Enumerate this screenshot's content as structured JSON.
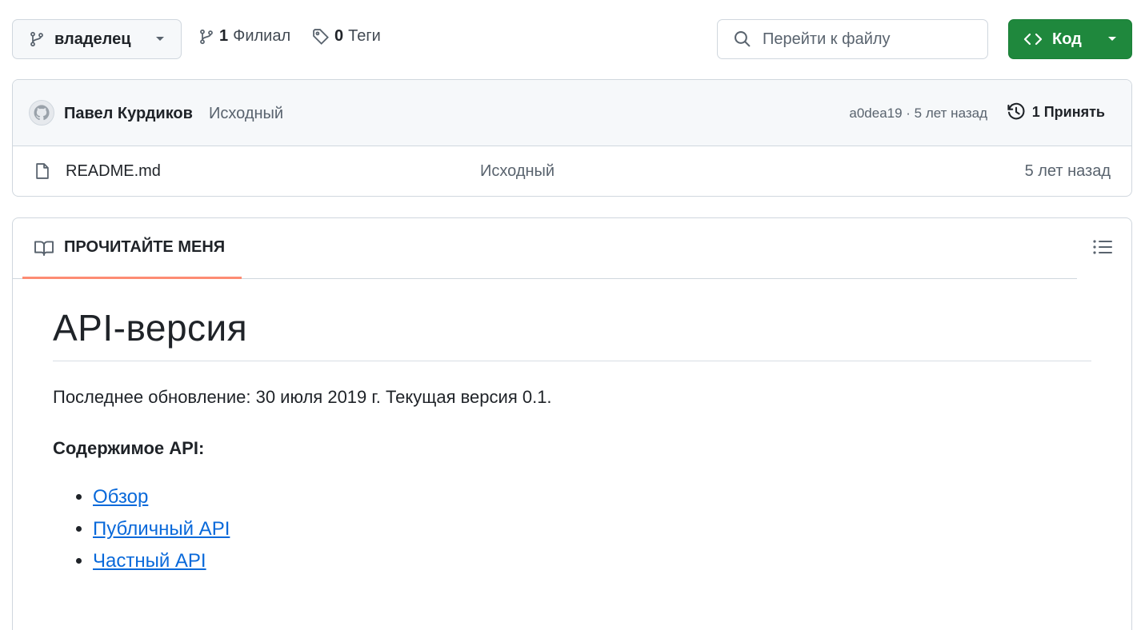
{
  "toolbar": {
    "branch": "владелец",
    "branches_count": "1",
    "branches_label": "Филиал",
    "tags_count": "0",
    "tags_label": "Теги",
    "search_placeholder": "Перейти к файлу",
    "code_label": "Код"
  },
  "commit": {
    "author": "Павел Курдиков",
    "message": "Исходный",
    "meta": "a0dea19 · 5 лет назад",
    "commits_count": "1",
    "commits_label": "Принять"
  },
  "files": [
    {
      "name": "README.md",
      "message": "Исходный",
      "date": "5 лет назад"
    }
  ],
  "readme": {
    "tab_label": "ПРОЧИТАЙТЕ МЕНЯ",
    "title": "API-версия",
    "paragraph": "Последнее обновление: 30 июля 2019 г. Текущая версия 0.1.",
    "subheading": "Содержимое API:",
    "links": [
      "Обзор",
      "Публичный API",
      "Частный API"
    ]
  },
  "colors": {
    "accent_green": "#1f883d",
    "link_blue": "#0969da",
    "tab_underline": "#fd8c73"
  },
  "icons": [
    "git-branch-icon",
    "caret-down-icon",
    "tag-icon",
    "search-icon",
    "code-icon",
    "history-icon",
    "file-icon",
    "book-icon",
    "list-icon"
  ]
}
